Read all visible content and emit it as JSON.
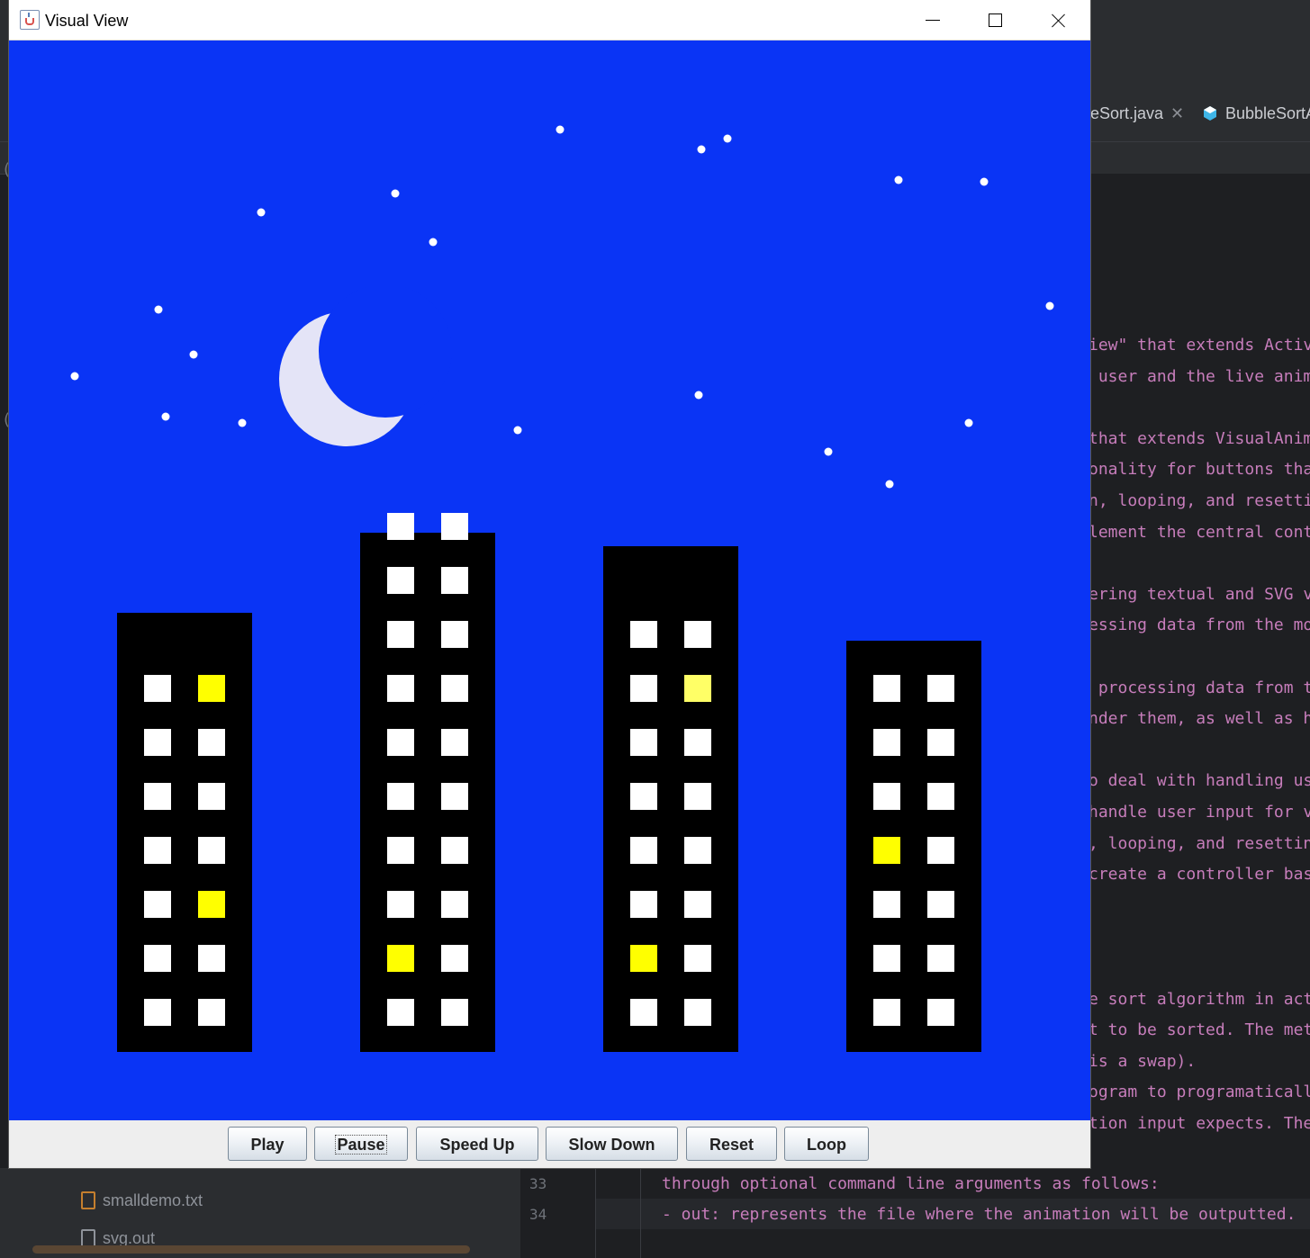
{
  "window": {
    "title": "Visual View"
  },
  "controls": {
    "buttons": [
      {
        "label": "Play"
      },
      {
        "label": "Pause"
      },
      {
        "label": "Speed Up"
      },
      {
        "label": "Slow Down"
      },
      {
        "label": "Reset"
      },
      {
        "label": "Loop"
      }
    ]
  },
  "scene": {
    "sky_color": "#0a34f5",
    "moon_color": "#e4e4f7",
    "building_color": "#000000",
    "window_off_color": "#ffffff",
    "window_on_color": "#ffff00",
    "window_dim_color": "#ffff66",
    "buildings": [
      {
        "name": "building-1",
        "windows": [
          [
            "white",
            "yellow"
          ],
          [
            "white",
            "white"
          ],
          [
            "white",
            "white"
          ],
          [
            "white",
            "white"
          ],
          [
            "white",
            "yellow"
          ],
          [
            "white",
            "white"
          ],
          [
            "white",
            "white"
          ]
        ]
      },
      {
        "name": "building-2",
        "windows": [
          [
            "white",
            "white"
          ],
          [
            "white",
            "white"
          ],
          [
            "white",
            "white"
          ],
          [
            "white",
            "white"
          ],
          [
            "white",
            "white"
          ],
          [
            "white",
            "white"
          ],
          [
            "white",
            "white"
          ],
          [
            "white",
            "white"
          ],
          [
            "yellow",
            "white"
          ],
          [
            "white",
            "white"
          ]
        ]
      },
      {
        "name": "building-3",
        "windows": [
          [
            "white",
            "white"
          ],
          [
            "white",
            "dim"
          ],
          [
            "white",
            "white"
          ],
          [
            "white",
            "white"
          ],
          [
            "white",
            "white"
          ],
          [
            "white",
            "white"
          ],
          [
            "yellow",
            "white"
          ],
          [
            "white",
            "white"
          ]
        ]
      },
      {
        "name": "building-4",
        "windows": [
          [
            "white",
            "white"
          ],
          [
            "white",
            "white"
          ],
          [
            "white",
            "white"
          ],
          [
            "yellow",
            "white"
          ],
          [
            "white",
            "white"
          ],
          [
            "white",
            "white"
          ],
          [
            "white",
            "white"
          ]
        ]
      }
    ],
    "star_count": 21
  },
  "ide": {
    "tabs": [
      {
        "label": "eSort.java"
      },
      {
        "label": "BubbleSortA"
      }
    ],
    "code_lines": [
      "iew\" that extends Activ",
      " user and the live anim",
      "",
      "that extends VisualAnim",
      "onality for buttons tha",
      "n, looping, and resetti",
      "lement the central cont",
      "",
      "ering textual and SVG v",
      "essing data from the mo",
      "",
      " processing data from t",
      "nder them, as well as h",
      "",
      "o deal with handling us",
      "handle user input for v",
      ", looping, and resettin",
      "create a controller bas",
      "",
      "",
      "",
      "e sort algorithm in act",
      "t to be sorted. The met",
      "is a swap).",
      "ogram to programaticall",
      "tion input expects. The"
    ],
    "numbered_lines": [
      {
        "num": "33",
        "text": "through optional command line arguments as follows:"
      },
      {
        "num": "34",
        "text": "- out: represents the file where the animation will be outputted."
      }
    ],
    "project_files": [
      {
        "name": "smalldemo.txt"
      },
      {
        "name": "svg.out"
      }
    ]
  }
}
